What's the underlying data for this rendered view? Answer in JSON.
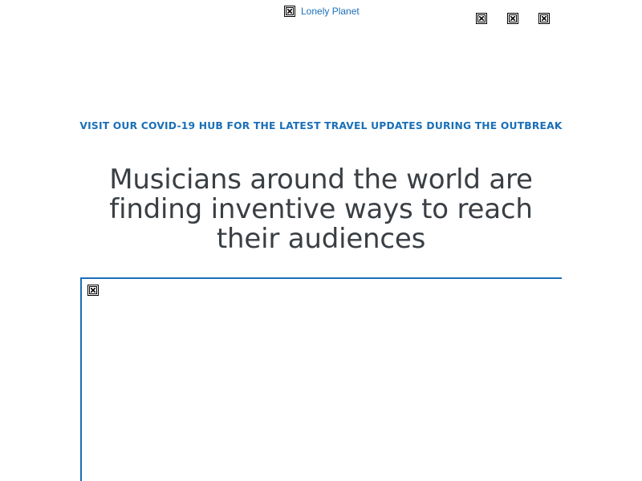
{
  "header": {
    "logo": {
      "text": "Lonely Planet",
      "icon": "broken-image-icon"
    },
    "toolbar_icons": [
      "broken-image-icon",
      "broken-image-icon",
      "broken-image-icon"
    ]
  },
  "banner": {
    "text": "VISIT OUR COVID-19 HUB FOR THE LATEST TRAVEL UPDATES DURING THE OUTBREAK"
  },
  "article": {
    "title": "Musicians around the world are finding inventive ways to reach their audiences",
    "hero_media_icon": "broken-image-icon"
  },
  "colors": {
    "accent": "#1a6fb8",
    "headline": "#3a3f44",
    "background": "#ffffff"
  }
}
